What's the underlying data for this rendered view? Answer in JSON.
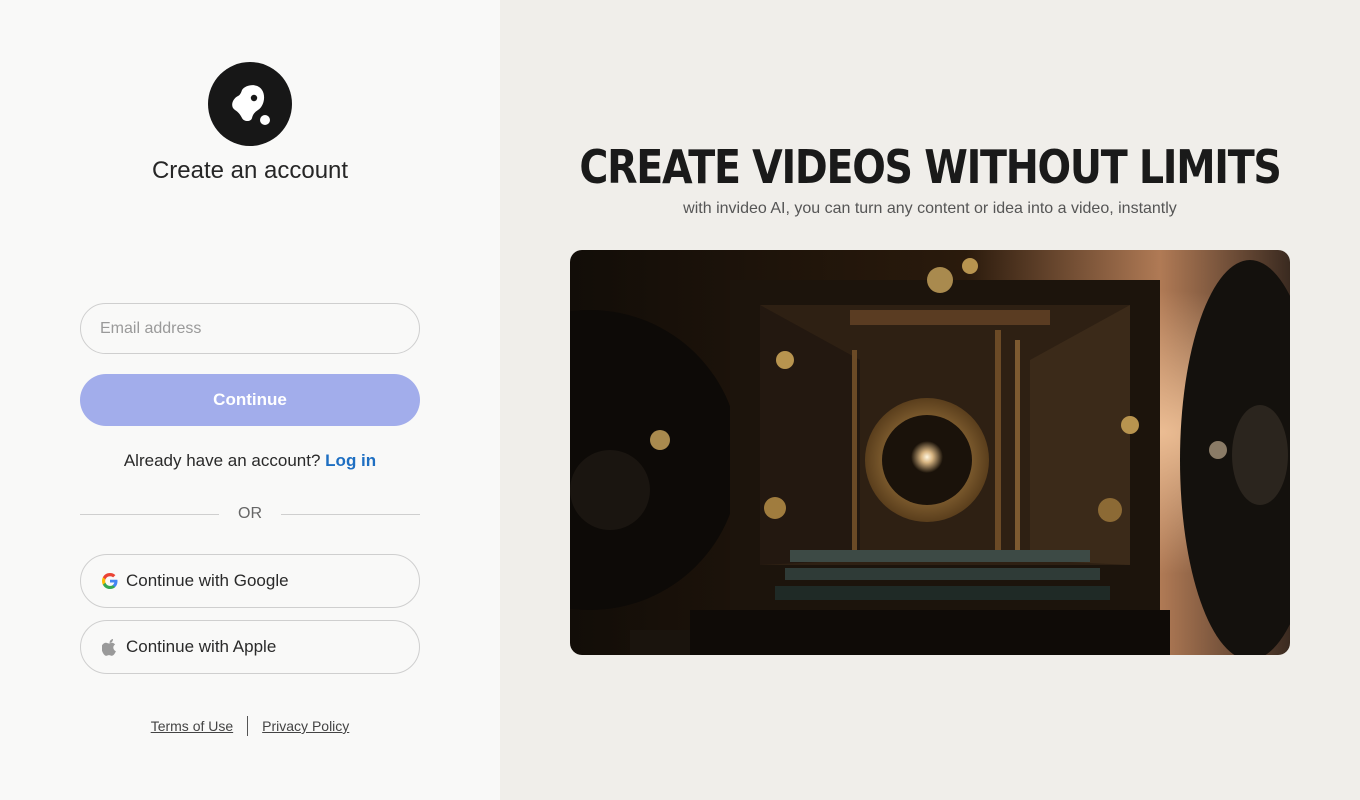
{
  "auth": {
    "title": "Create an account",
    "email_placeholder": "Email address",
    "continue_label": "Continue",
    "login_prompt": "Already have an account?",
    "login_link": "Log in",
    "divider_text": "OR",
    "google_label": "Continue with Google",
    "apple_label": "Continue with Apple"
  },
  "footer": {
    "terms": "Terms of Use",
    "privacy": "Privacy Policy"
  },
  "hero": {
    "title": "CREATE VIDEOS WITHOUT LIMITS",
    "subtitle": "with invideo AI, you can turn any content or idea into a video, instantly"
  },
  "colors": {
    "accent": "#a2adeb",
    "link": "#1e6fc2",
    "logo_bg": "#171717",
    "right_bg": "#f0eeea"
  },
  "icons": [
    "brand-logo-icon",
    "google-icon",
    "apple-icon"
  ]
}
